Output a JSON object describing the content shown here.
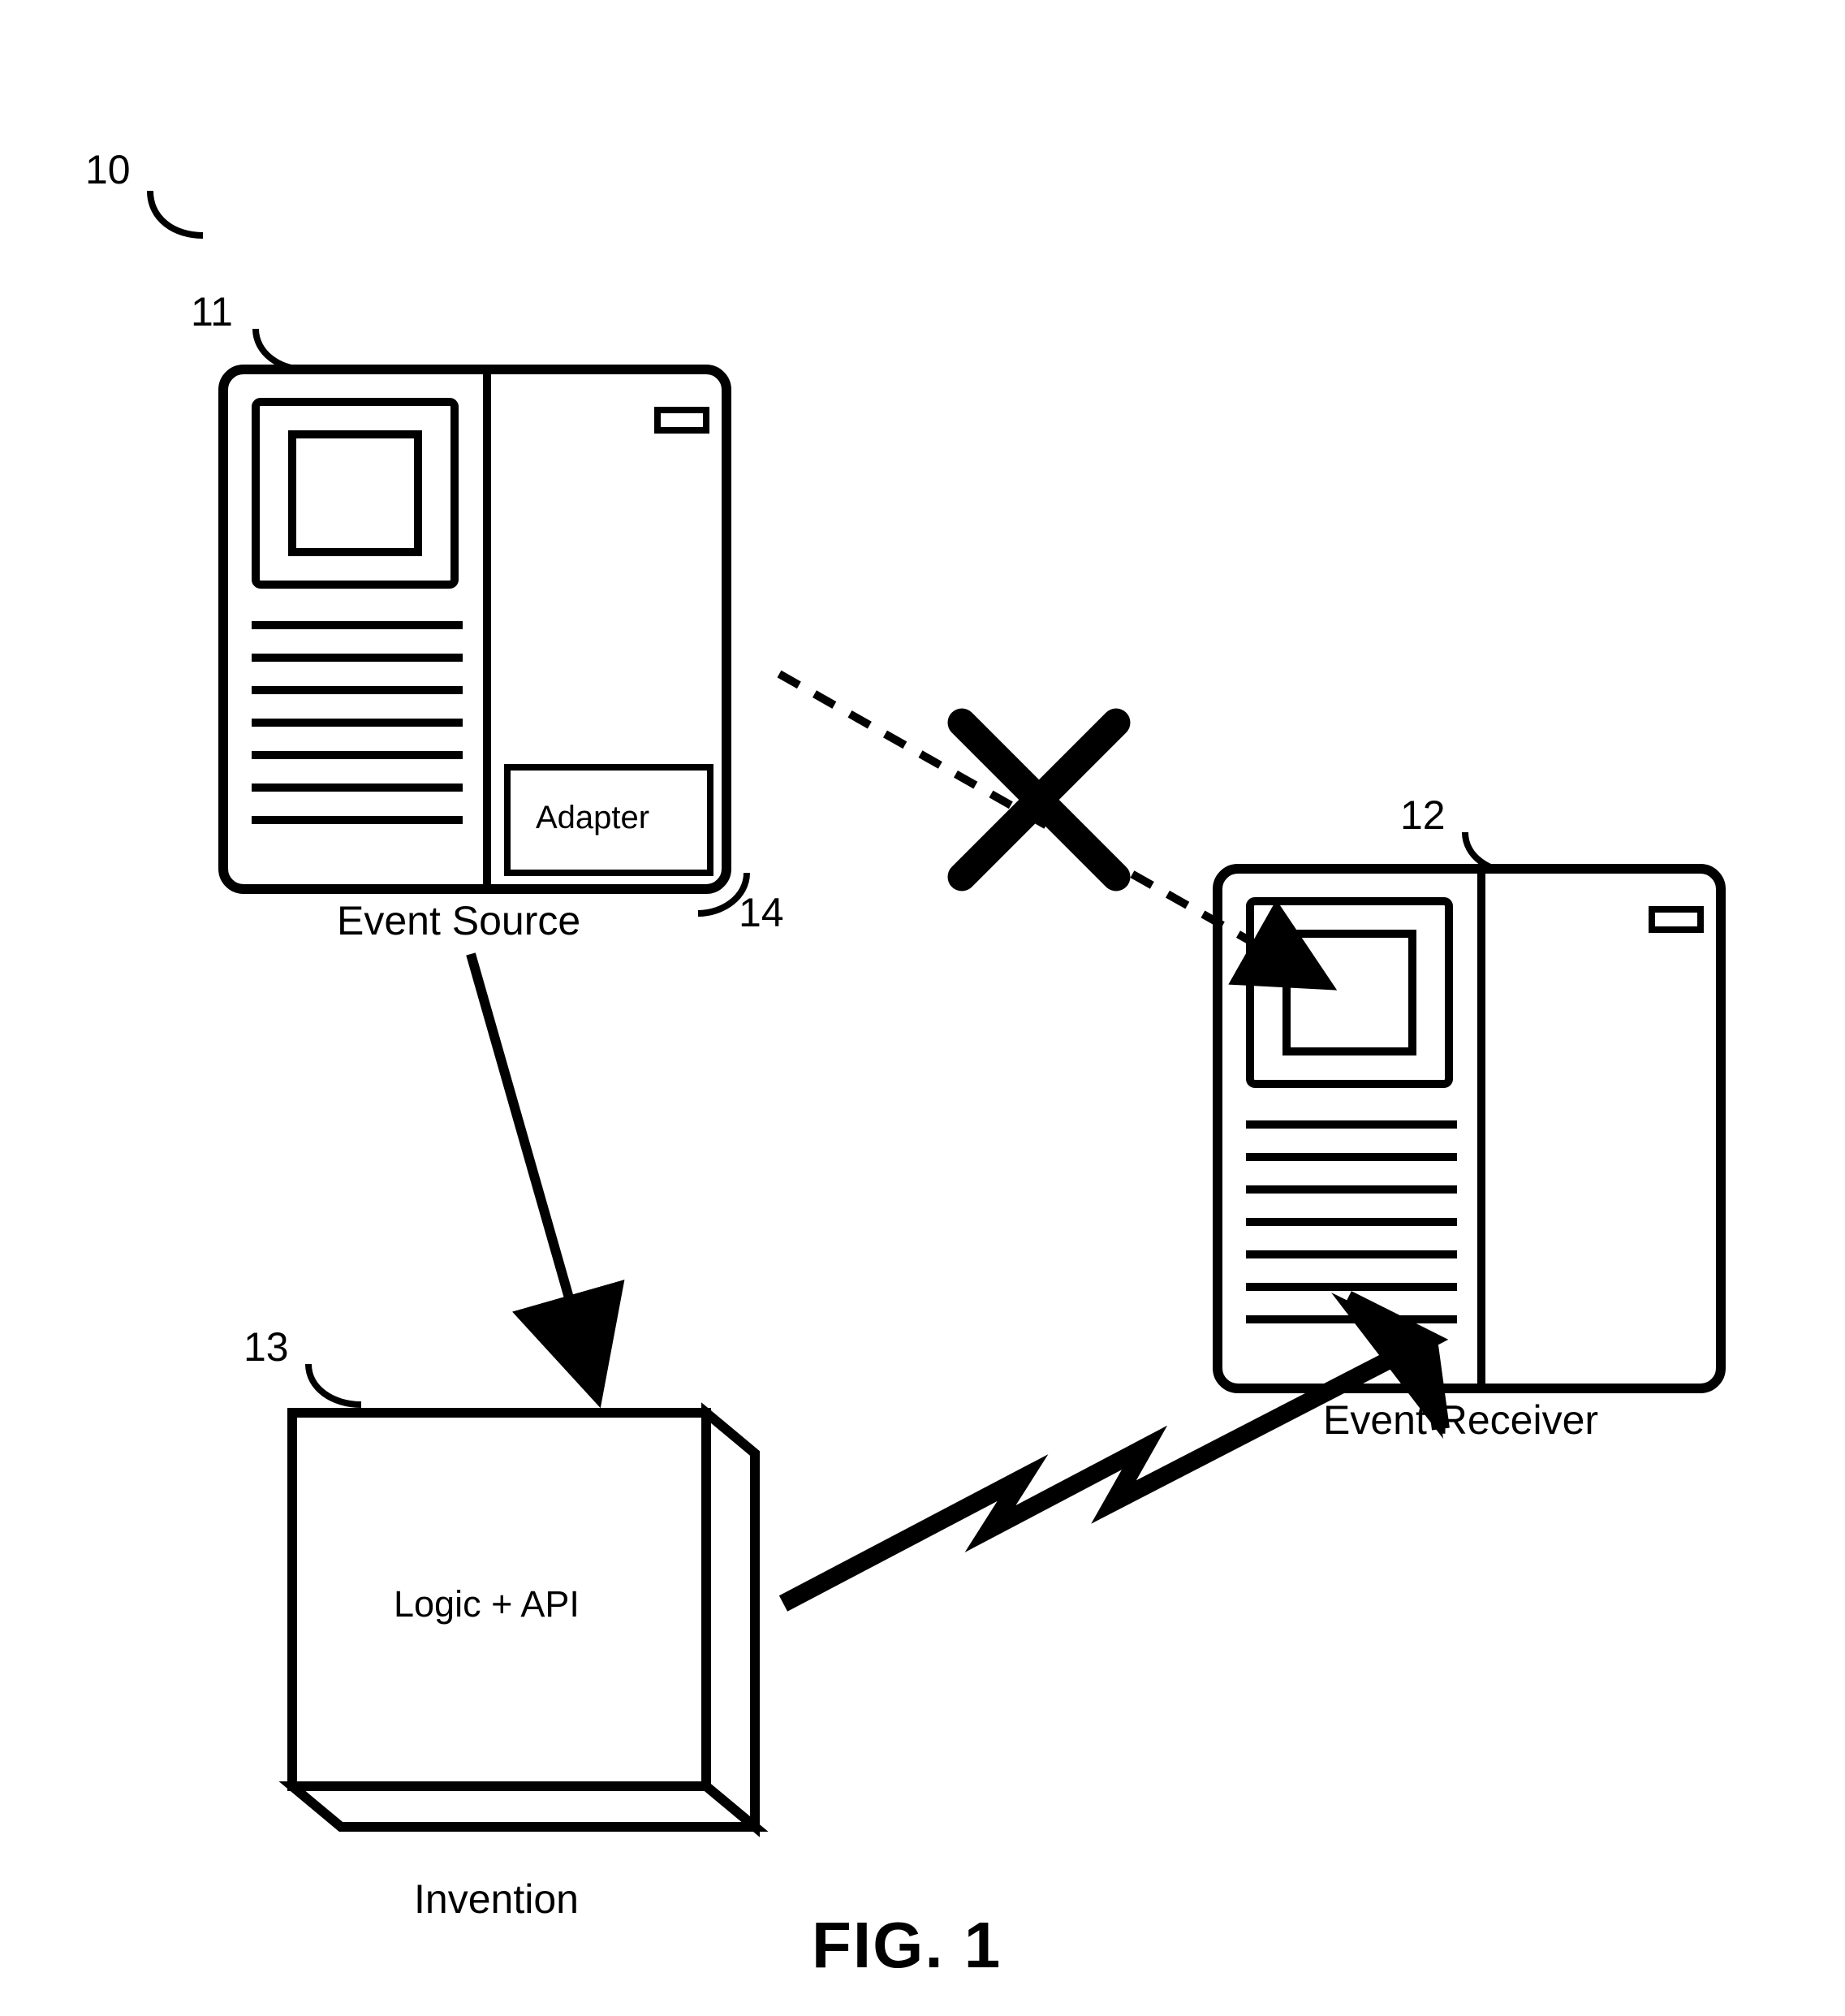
{
  "refs": {
    "system": "10",
    "source": "11",
    "receiver": "12",
    "invention": "13",
    "adapter": "14"
  },
  "labels": {
    "source_caption": "Event Source",
    "receiver_caption": "Event Receiver",
    "invention_caption": "Invention",
    "adapter_label": "Adapter",
    "invention_label": "Logic + API",
    "figure_caption": "FIG. 1"
  }
}
